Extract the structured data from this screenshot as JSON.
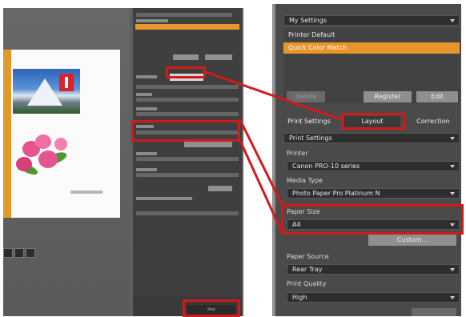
{
  "right_panel": {
    "settings_dropdown": "My Settings",
    "settings_list": [
      "Printer Default",
      "Quick Color Match"
    ],
    "selected_index": 1,
    "buttons": {
      "delete": "Delete",
      "register": "Register",
      "edit": "Edit"
    },
    "tabs": [
      "Print Settings",
      "Layout",
      "Correction"
    ],
    "print_settings_dropdown": "Print Settings",
    "printer_label": "Printer",
    "printer_value": "Canon PRO-10 series",
    "media_type_label": "Media Type",
    "media_type_value": "Photo Paper Pro Platinum N",
    "paper_size_label": "Paper Size",
    "paper_size_value": "A4",
    "custom_button": "Custom...",
    "paper_source_label": "Paper Source",
    "paper_source_value": "Rear Tray",
    "print_quality_label": "Print Quality",
    "print_quality_value": "High"
  },
  "left_panel": {
    "layout_tab": "Layout",
    "print_button": "Print"
  },
  "colors": {
    "accent_orange": "#e8952c",
    "highlight_red": "#d21a1a",
    "panel_bg": "#4a4a4a"
  }
}
